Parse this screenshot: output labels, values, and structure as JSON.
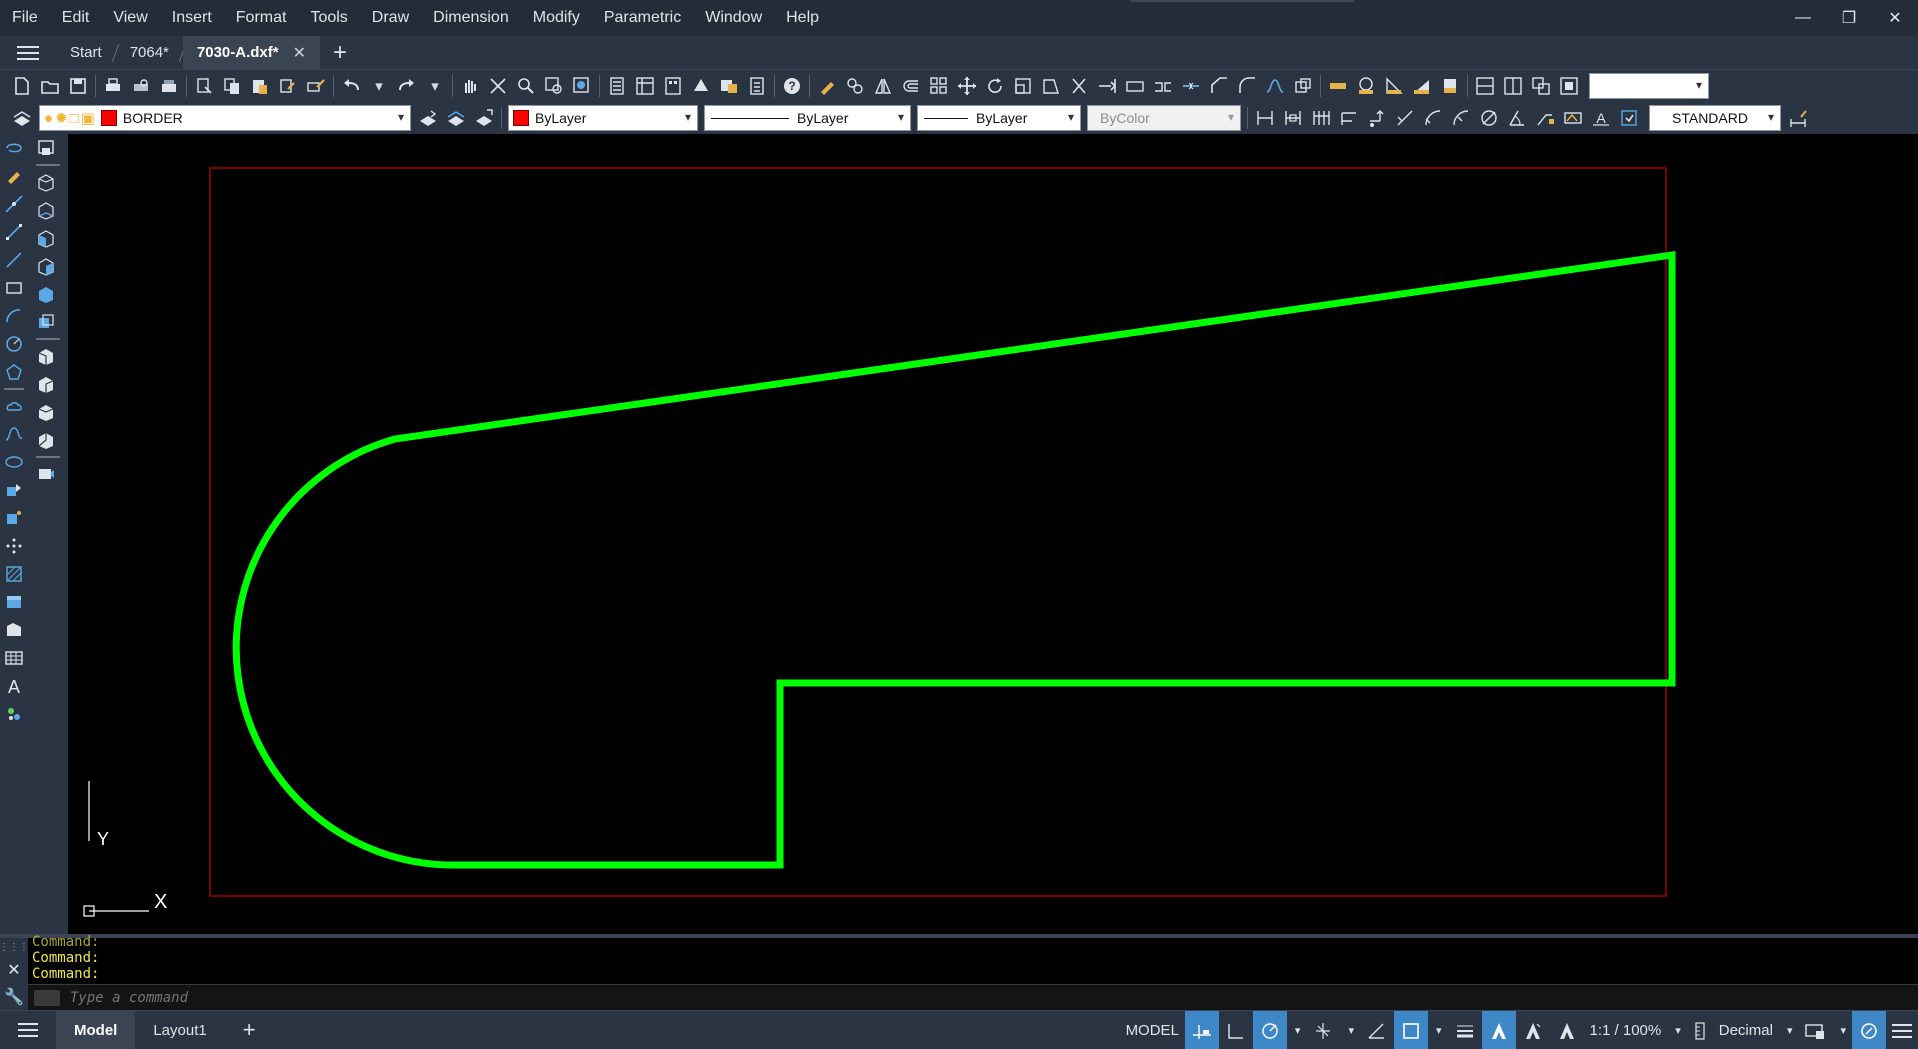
{
  "menu": [
    "File",
    "Edit",
    "View",
    "Insert",
    "Format",
    "Tools",
    "Draw",
    "Dimension",
    "Modify",
    "Parametric",
    "Window",
    "Help"
  ],
  "window_controls": {
    "minimize": "—",
    "restore": "❐",
    "close": "✕"
  },
  "tabs": [
    {
      "label": "Start",
      "active": false
    },
    {
      "label": "7064*",
      "active": false
    },
    {
      "label": "7030-A.dxf*",
      "active": true
    }
  ],
  "tab_close_glyph": "✕",
  "tab_add_glyph": "+",
  "properties": {
    "layer": "BORDER",
    "color": "ByLayer",
    "linetype": "ByLayer",
    "lineweight": "ByLayer",
    "plotstyle": "ByColor",
    "dimstyle": "STANDARD",
    "layer_color": "#ff0000",
    "color_swatch": "#ff0000"
  },
  "ucs": {
    "x_label": "X",
    "y_label": "Y"
  },
  "drawing": {
    "outline_color": "#00ff00",
    "border_color": "#cc0000",
    "background": "#000000"
  },
  "command": {
    "history": [
      "Command:",
      "Command:",
      "Command:"
    ],
    "placeholder": "Type a command"
  },
  "status": {
    "layout_tabs": [
      {
        "label": "Model",
        "active": true
      },
      {
        "label": "Layout1",
        "active": false
      }
    ],
    "add_layout_glyph": "+",
    "mode": "MODEL",
    "scale": "1:1 / 100%",
    "units": "Decimal"
  }
}
